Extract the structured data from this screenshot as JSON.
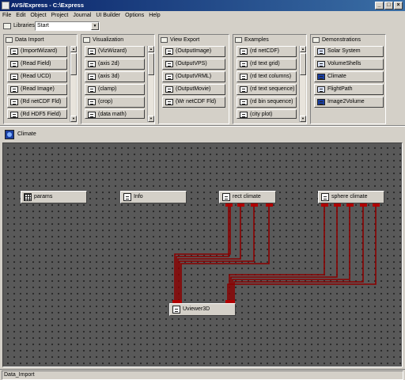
{
  "window": {
    "title": "AVS/Express - C:\\Express"
  },
  "menu": [
    "File",
    "Edit",
    "Object",
    "Project",
    "Journal",
    "UI Builder",
    "Options",
    "Help"
  ],
  "libraries": {
    "label": "Libraries",
    "selected": "Start"
  },
  "panels": [
    {
      "title": "Data Import",
      "items": [
        "(ImportWizard)",
        "(Read Field)",
        "(Read UCD)",
        "(Read Image)",
        "(Rd netCDF Fld)",
        "(Rd HDF5 Field)"
      ]
    },
    {
      "title": "Visualization",
      "items": [
        "(VizWizard)",
        "(axis 2d)",
        "(axis 3d)",
        "(clamp)",
        "(crop)",
        "(data math)"
      ]
    },
    {
      "title": "View Export",
      "items": [
        "(OutputImage)",
        "(OutputVPS)",
        "(OutputVRML)",
        "(OutputMovie)",
        "(Wr netCDF Fld)"
      ]
    },
    {
      "title": "Examples",
      "items": [
        "(rd netCDF)",
        "(rd text grid)",
        "(rd text columns)",
        "(rd text sequence)",
        "(rd bin sequence)",
        "(city plot)"
      ]
    },
    {
      "title": "Demonstrations",
      "items": [
        "Solar System",
        "VolumeShells",
        "Climate",
        "FlightPath",
        "Image2Volume"
      ]
    }
  ],
  "context": {
    "label": "Climate"
  },
  "network": {
    "nodes": [
      {
        "id": "params",
        "label": "params",
        "icon": "grid-icon"
      },
      {
        "id": "info",
        "label": "Info",
        "icon": "module-icon"
      },
      {
        "id": "rect",
        "label": "rect climate",
        "icon": "module-icon"
      },
      {
        "id": "sphere",
        "label": "sphere climate",
        "icon": "module-icon"
      },
      {
        "id": "uviewer",
        "label": "Uviewer3D",
        "icon": "module-icon"
      }
    ],
    "wire_color": "#8b0000",
    "port_color": "#b00000"
  },
  "status": {
    "text": "Data_Import"
  }
}
